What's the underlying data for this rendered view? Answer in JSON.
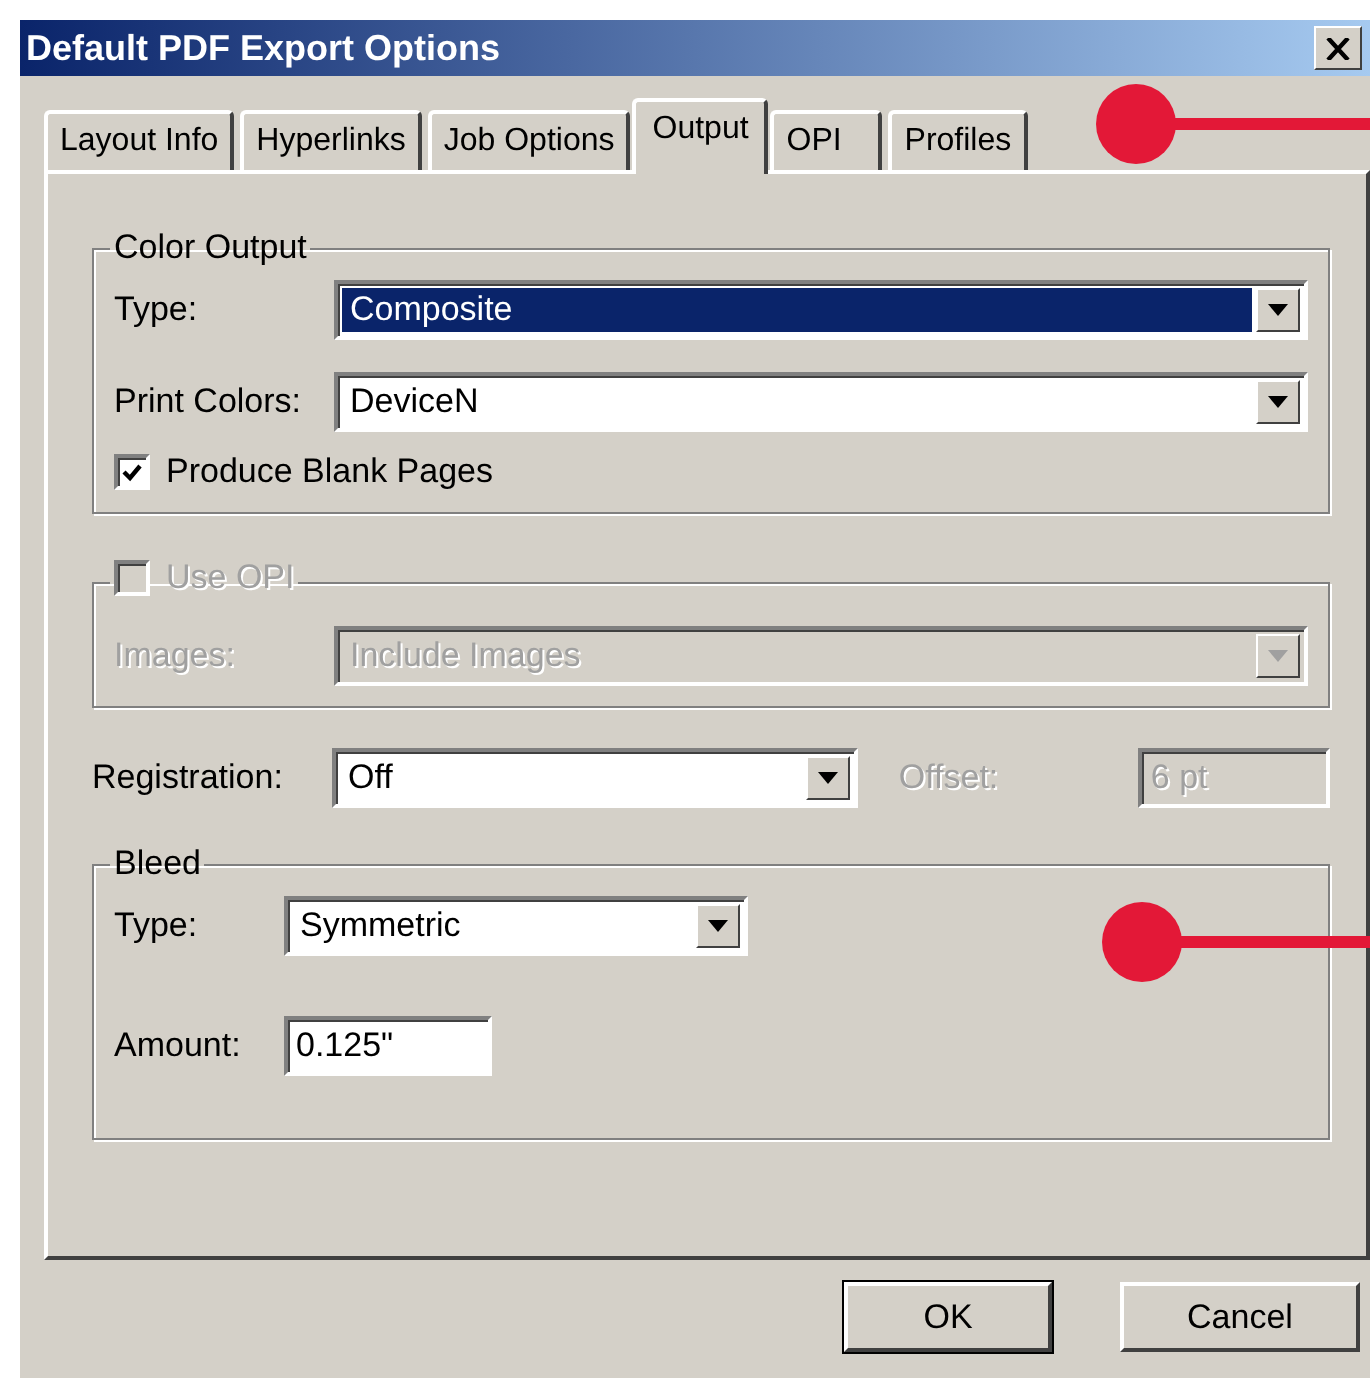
{
  "window": {
    "title": "Default PDF Export Options"
  },
  "tabs": [
    {
      "label": "Layout Info",
      "selected": false
    },
    {
      "label": "Hyperlinks",
      "selected": false
    },
    {
      "label": "Job Options",
      "selected": false
    },
    {
      "label": "Output",
      "selected": true
    },
    {
      "label": "OPI",
      "selected": false
    },
    {
      "label": "Profiles",
      "selected": false
    }
  ],
  "color_output": {
    "legend": "Color Output",
    "type": {
      "label": "Type:",
      "value": "Composite",
      "focused": true
    },
    "print_colors": {
      "label": "Print Colors:",
      "value": "DeviceN",
      "focused": false
    },
    "produce_blank_pages": {
      "label": "Produce Blank Pages",
      "checked": true
    }
  },
  "opi": {
    "label": "Use OPI",
    "checked": false,
    "disabled": true,
    "images": {
      "label": "Images:",
      "value": "Include Images"
    }
  },
  "registration": {
    "label": "Registration:",
    "value": "Off"
  },
  "offset": {
    "label": "Offset:",
    "value": "6 pt",
    "disabled": true
  },
  "bleed": {
    "legend": "Bleed",
    "type": {
      "label": "Type:",
      "value": "Symmetric"
    },
    "amount": {
      "label": "Amount:",
      "value": "0.125\""
    }
  },
  "buttons": [
    {
      "label": "OK",
      "default": true
    },
    {
      "label": "Cancel",
      "default": false
    }
  ]
}
